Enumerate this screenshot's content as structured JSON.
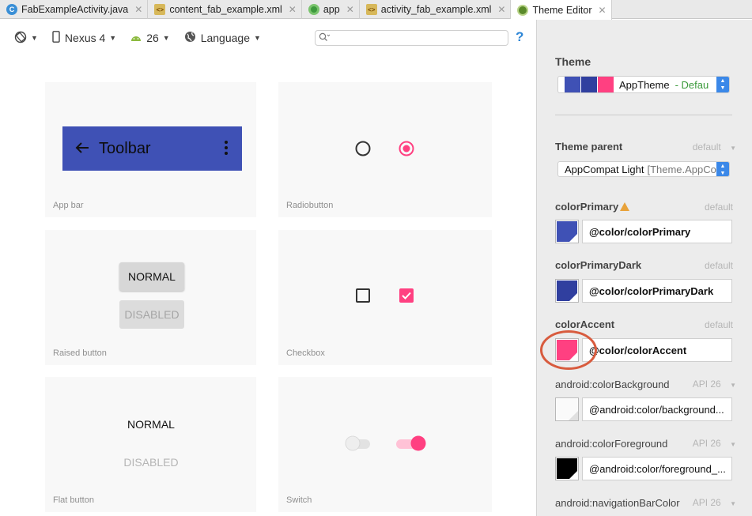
{
  "tabs": [
    {
      "label": "FabExampleActivity.java",
      "icon": "java-class-icon"
    },
    {
      "label": "content_fab_example.xml",
      "icon": "xml-file-icon"
    },
    {
      "label": "app",
      "icon": "app-module-icon"
    },
    {
      "label": "activity_fab_example.xml",
      "icon": "xml-file-icon"
    },
    {
      "label": "Theme Editor",
      "icon": "theme-editor-icon"
    }
  ],
  "preview_toolbar": {
    "device": "Nexus 4",
    "api": "26",
    "language": "Language",
    "help": "?"
  },
  "preview": {
    "appbar": {
      "title": "Toolbar",
      "label": "App bar"
    },
    "radiobutton": {
      "label": "Radiobutton"
    },
    "raised_button": {
      "normal": "NORMAL",
      "disabled": "DISABLED",
      "label": "Raised button"
    },
    "checkbox": {
      "label": "Checkbox"
    },
    "flat_button": {
      "normal": "NORMAL",
      "disabled": "DISABLED",
      "label": "Flat button"
    },
    "switch": {
      "label": "Switch"
    }
  },
  "theme_panel": {
    "theme_title": "Theme",
    "theme_name": "AppTheme",
    "theme_suffix": "- Defau",
    "parent_title": "Theme parent",
    "parent_default": "default",
    "parent_value": "AppCompat Light",
    "parent_value_extra": "[Theme.AppCom",
    "attributes": [
      {
        "name": "colorPrimary",
        "default": "default",
        "value": "@color/colorPrimary",
        "color": "#3f51b5"
      },
      {
        "name": "colorPrimaryDark",
        "default": "default",
        "value": "@color/colorPrimaryDark",
        "color": "#303f9f"
      },
      {
        "name": "colorAccent",
        "default": "default",
        "value": "@color/colorAccent",
        "color": "#ff4081"
      },
      {
        "name": "android:colorBackground",
        "default": "API 26",
        "value": "@android:color/background...",
        "color": "#fafafa"
      },
      {
        "name": "android:colorForeground",
        "default": "API 26",
        "value": "@android:color/foreground_...",
        "color": "#000000"
      },
      {
        "name": "android:navigationBarColor",
        "default": "API 26"
      }
    ]
  },
  "colors": {
    "primary": "#3f51b5",
    "primary_dark": "#303f9f",
    "accent": "#ff4081",
    "panel_bg": "#ececec",
    "highlight": "#d85b3e"
  }
}
